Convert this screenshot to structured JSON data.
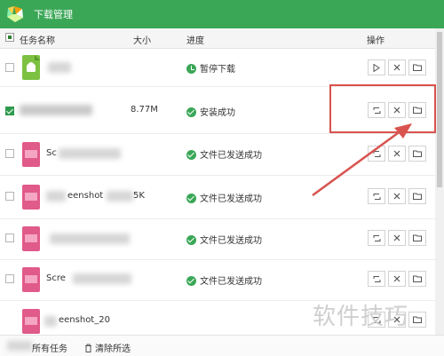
{
  "window": {
    "title": "下载管理"
  },
  "columns": {
    "name": "任务名称",
    "size": "大小",
    "progress": "进度",
    "actions": "操作"
  },
  "rows": [
    {
      "name": "",
      "size": "",
      "status": "暂停下载",
      "status_icon": "clock-icon",
      "checked": false,
      "first_action": "play-icon"
    },
    {
      "name": "",
      "size": "8.77M",
      "status": "安装成功",
      "status_icon": "check-circle-icon",
      "checked": true,
      "first_action": "refresh-icon"
    },
    {
      "name": "Sc",
      "size": "",
      "status": "文件已发送成功",
      "status_icon": "check-circle-icon",
      "checked": false,
      "first_action": "refresh-icon"
    },
    {
      "name": "eenshot",
      "size": "5K",
      "status": "文件已发送成功",
      "status_icon": "check-circle-icon",
      "checked": false,
      "first_action": "refresh-icon"
    },
    {
      "name": "",
      "size": "",
      "status": "文件已发送成功",
      "status_icon": "check-circle-icon",
      "checked": false,
      "first_action": "refresh-icon"
    },
    {
      "name": "Scre",
      "size": "",
      "status": "文件已发送成功",
      "status_icon": "check-circle-icon",
      "checked": false,
      "first_action": "refresh-icon"
    },
    {
      "name": "eenshot_20",
      "size": "",
      "status": "",
      "status_icon": "",
      "checked": false,
      "first_action": "refresh-icon"
    }
  ],
  "footer": {
    "all_tasks": "所有任务",
    "clear": "清除所选"
  },
  "watermark": "软件技巧"
}
